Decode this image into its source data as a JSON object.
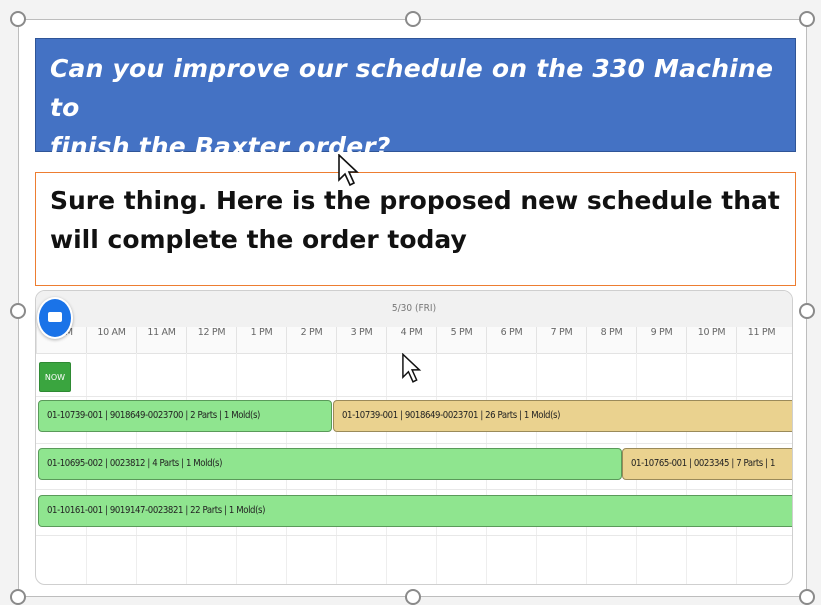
{
  "question": {
    "line1": "Can you improve our schedule on the 330 Machine to",
    "line2": "finish the Baxter order?",
    "bg_color": "#4472c4"
  },
  "answer": {
    "line1": "Sure thing. Here is the proposed new schedule that",
    "line2": "will complete the order today",
    "border_color": "#ed7d31"
  },
  "scheduler": {
    "date": "5/30 (FRI)",
    "hours": [
      "9 AM",
      "10 AM",
      "11 AM",
      "12 PM",
      "1 PM",
      "2 PM",
      "3 PM",
      "4 PM",
      "5 PM",
      "6 PM",
      "7 PM",
      "8 PM",
      "9 PM",
      "10 PM",
      "11 PM"
    ],
    "now_label": "NOW",
    "fab_icon": "mail-icon",
    "rows": [
      {
        "jobs": [
          {
            "label": "01-10739-001 | 9018649-0023700 | 2 Parts | 1 Mold(s)",
            "color": "green"
          },
          {
            "label": "01-10739-001 | 9018649-0023701 | 26 Parts | 1 Mold(s)",
            "color": "tan"
          }
        ]
      },
      {
        "jobs": [
          {
            "label": "01-10695-002 | 0023812 | 4 Parts | 1 Mold(s)",
            "color": "green"
          },
          {
            "label": "01-10765-001 | 0023345 | 7 Parts | 1",
            "color": "tan"
          }
        ]
      },
      {
        "jobs": [
          {
            "label": "01-10161-001 | 9019147-0023821 | 22 Parts | 1 Mold(s)",
            "color": "green"
          }
        ]
      }
    ]
  },
  "colors": {
    "job_green": "#8fe58f",
    "job_tan": "#ead28f",
    "now_green": "#3aa53f"
  }
}
